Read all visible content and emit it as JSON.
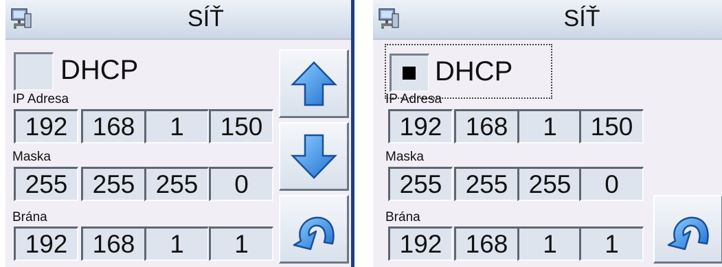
{
  "screens": [
    {
      "title": "SÍŤ",
      "dhcp": {
        "label": "DHCP",
        "checked": false,
        "focused": false
      },
      "ip": {
        "label": "IP Adresa",
        "octets": [
          "192",
          "168",
          "1",
          "150"
        ]
      },
      "mask": {
        "label": "Maska",
        "octets": [
          "255",
          "255",
          "255",
          "0"
        ]
      },
      "gateway": {
        "label": "Brána",
        "octets": [
          "192",
          "168",
          "1",
          "1"
        ]
      },
      "buttons": [
        "up-arrow-icon",
        "down-arrow-icon",
        "back-arrow-icon"
      ]
    },
    {
      "title": "SÍŤ",
      "dhcp": {
        "label": "DHCP",
        "checked": true,
        "focused": true
      },
      "ip": {
        "label": "IP Adresa",
        "octets": [
          "192",
          "168",
          "1",
          "150"
        ]
      },
      "mask": {
        "label": "Maska",
        "octets": [
          "255",
          "255",
          "255",
          "0"
        ]
      },
      "gateway": {
        "label": "Brána",
        "octets": [
          "192",
          "168",
          "1",
          "1"
        ]
      },
      "buttons": [
        "back-arrow-icon"
      ]
    }
  ],
  "colors": {
    "panel_bg": "#f1eef6",
    "field_bg": "#dde4ee",
    "accent_border": "#1f3f86",
    "arrow_blue": "#2f86e0"
  }
}
